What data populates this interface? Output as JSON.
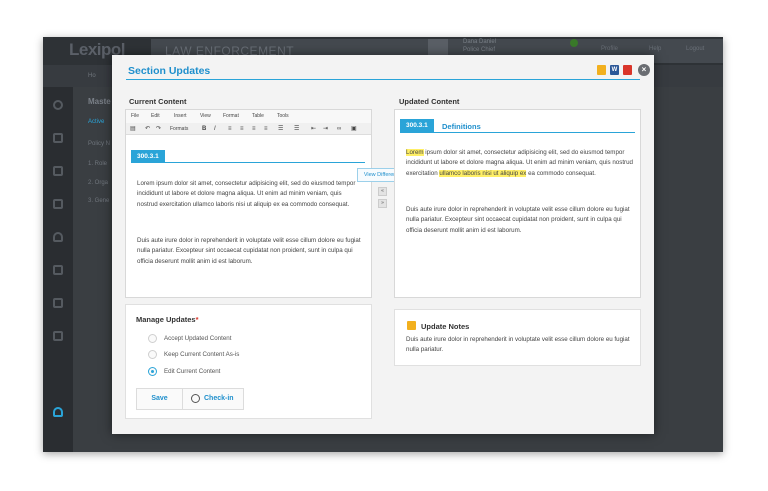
{
  "app": {
    "logo": "Lexipol",
    "title": "LAW ENFORCEMENT",
    "user_name": "Dana Daniel",
    "user_role": "Police Chief",
    "header_links": [
      "Profile",
      "Help",
      "Logout"
    ],
    "notification_count": "1",
    "breadcrumb": "Ho",
    "page_heading": "Maste",
    "tab_active": "Active",
    "policy_label": "Policy N",
    "list_items": [
      "1. Role",
      "2. Orga",
      "3. Gene"
    ]
  },
  "modal": {
    "title": "Section Updates",
    "header_icons": [
      "note-icon",
      "word-icon",
      "pdf-icon"
    ],
    "close_label": "×"
  },
  "current": {
    "label": "Current Content",
    "menu": [
      "File",
      "Edit",
      "Insert",
      "View",
      "Format",
      "Table",
      "Tools"
    ],
    "toolbar": [
      "Formats",
      "B",
      "I"
    ],
    "section_number": "300.3.1",
    "para1": "Lorem ipsum dolor sit amet, consectetur adipisicing elit, sed do eiusmod tempor incididunt ut labore et dolore magna aliqua. Ut enim ad minim veniam, quis nostrud exercitation ullamco laboris nisi ut aliquip ex ea commodo consequat.",
    "para2": "Duis aute irure dolor in reprehenderit in voluptate velit esse cillum dolore eu fugiat nulla pariatur. Excepteur sint occaecat cupidatat non proident, sunt in culpa qui officia deserunt mollit anim id est laborum."
  },
  "compare": {
    "view_difference": "View Difference",
    "prev_label": "«",
    "next_label": "»"
  },
  "updated": {
    "label": "Updated Content",
    "section_number": "300.3.1",
    "section_title": "Definitions",
    "para1_hl1": "Lorem",
    "para1_a": " ipsum dolor sit amet, consectetur adipisicing elit, sed do eiusmod tempor incididunt ut labore et dolore magna aliqua. Ut enim ad minim veniam, quis nostrud exercitation ",
    "para1_hl2": "ullamco laboris nisi ut aliquip ex",
    "para1_b": " ea commodo consequat.",
    "para2": "Duis aute irure dolor in reprehenderit in voluptate velit esse cillum dolore eu fugiat nulla pariatur. Excepteur sint occaecat cupidatat non proident, sunt in culpa qui officia deserunt mollit anim id est laborum.",
    "highlight_color": "#ffef66"
  },
  "manage": {
    "label": "Manage Updates",
    "required_mark": "*",
    "options": [
      "Accept Updated Content",
      "Keep Current Content As-is",
      "Edit Current Content"
    ],
    "selected": "Edit Current Content",
    "save_label": "Save",
    "checkin_label": "Check-in"
  },
  "notes": {
    "title": "Update Notes",
    "text": "Duis aute irure dolor in reprehenderit in voluptate velit esse cillum dolore eu fugiat nulla pariatur."
  },
  "colors": {
    "accent": "#2aa4d8",
    "title": "#1f8fcc"
  }
}
